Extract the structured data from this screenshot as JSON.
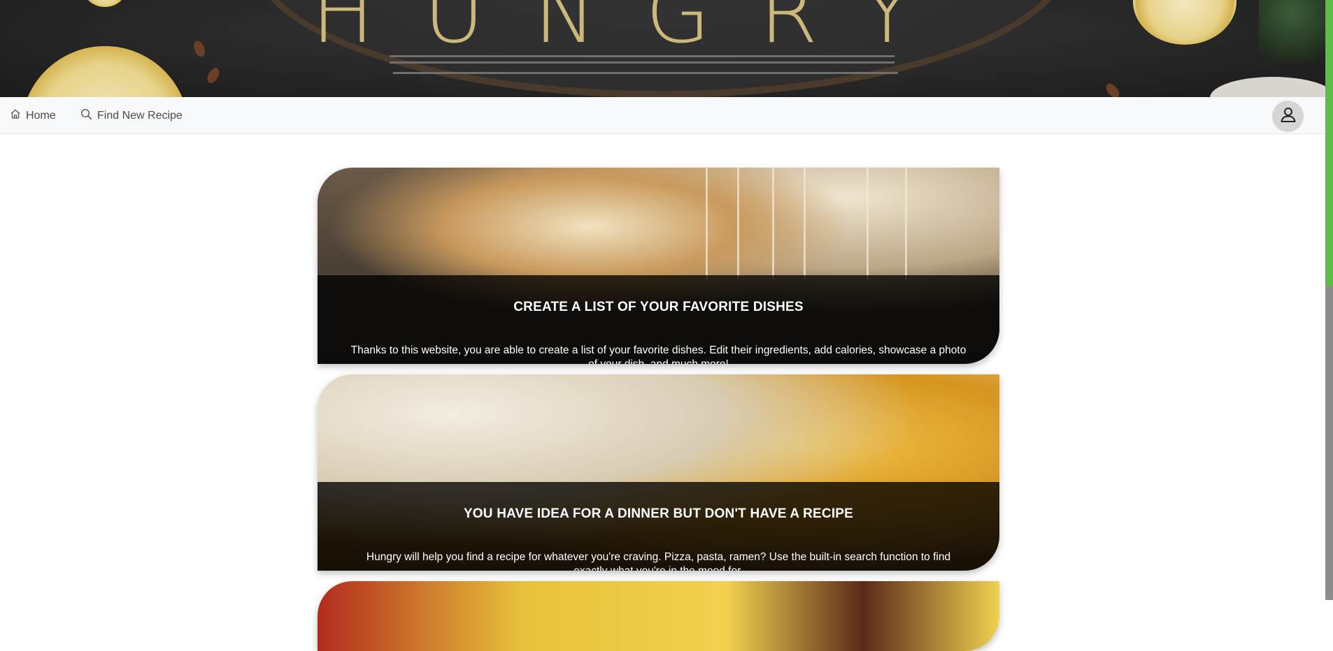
{
  "hero": {
    "brand_text": "HUNGRY"
  },
  "navbar": {
    "home_label": "Home",
    "find_label": "Find New Recipe",
    "icons": {
      "home": "home-icon",
      "find": "search-icon",
      "profile": "user-icon"
    }
  },
  "cards": [
    {
      "title": "CREATE A LIST OF YOUR FAVORITE DISHES",
      "text": "Thanks to this website, you are able to create a list of your favorite dishes. Edit their ingredients, add calories, showcase a photo of your dish, and much more!"
    },
    {
      "title": "YOU HAVE IDEA FOR A DINNER BUT DON'T HAVE A RECIPE",
      "text": "Hungry will help you find a recipe for whatever you're craving. Pizza, pasta, ramen? Use the built-in search function to find exactly what you're in the mood for."
    }
  ],
  "colors": {
    "accent": "#5bbf46",
    "navbar_bg": "#f8f9fa",
    "overlay": "#000000"
  }
}
